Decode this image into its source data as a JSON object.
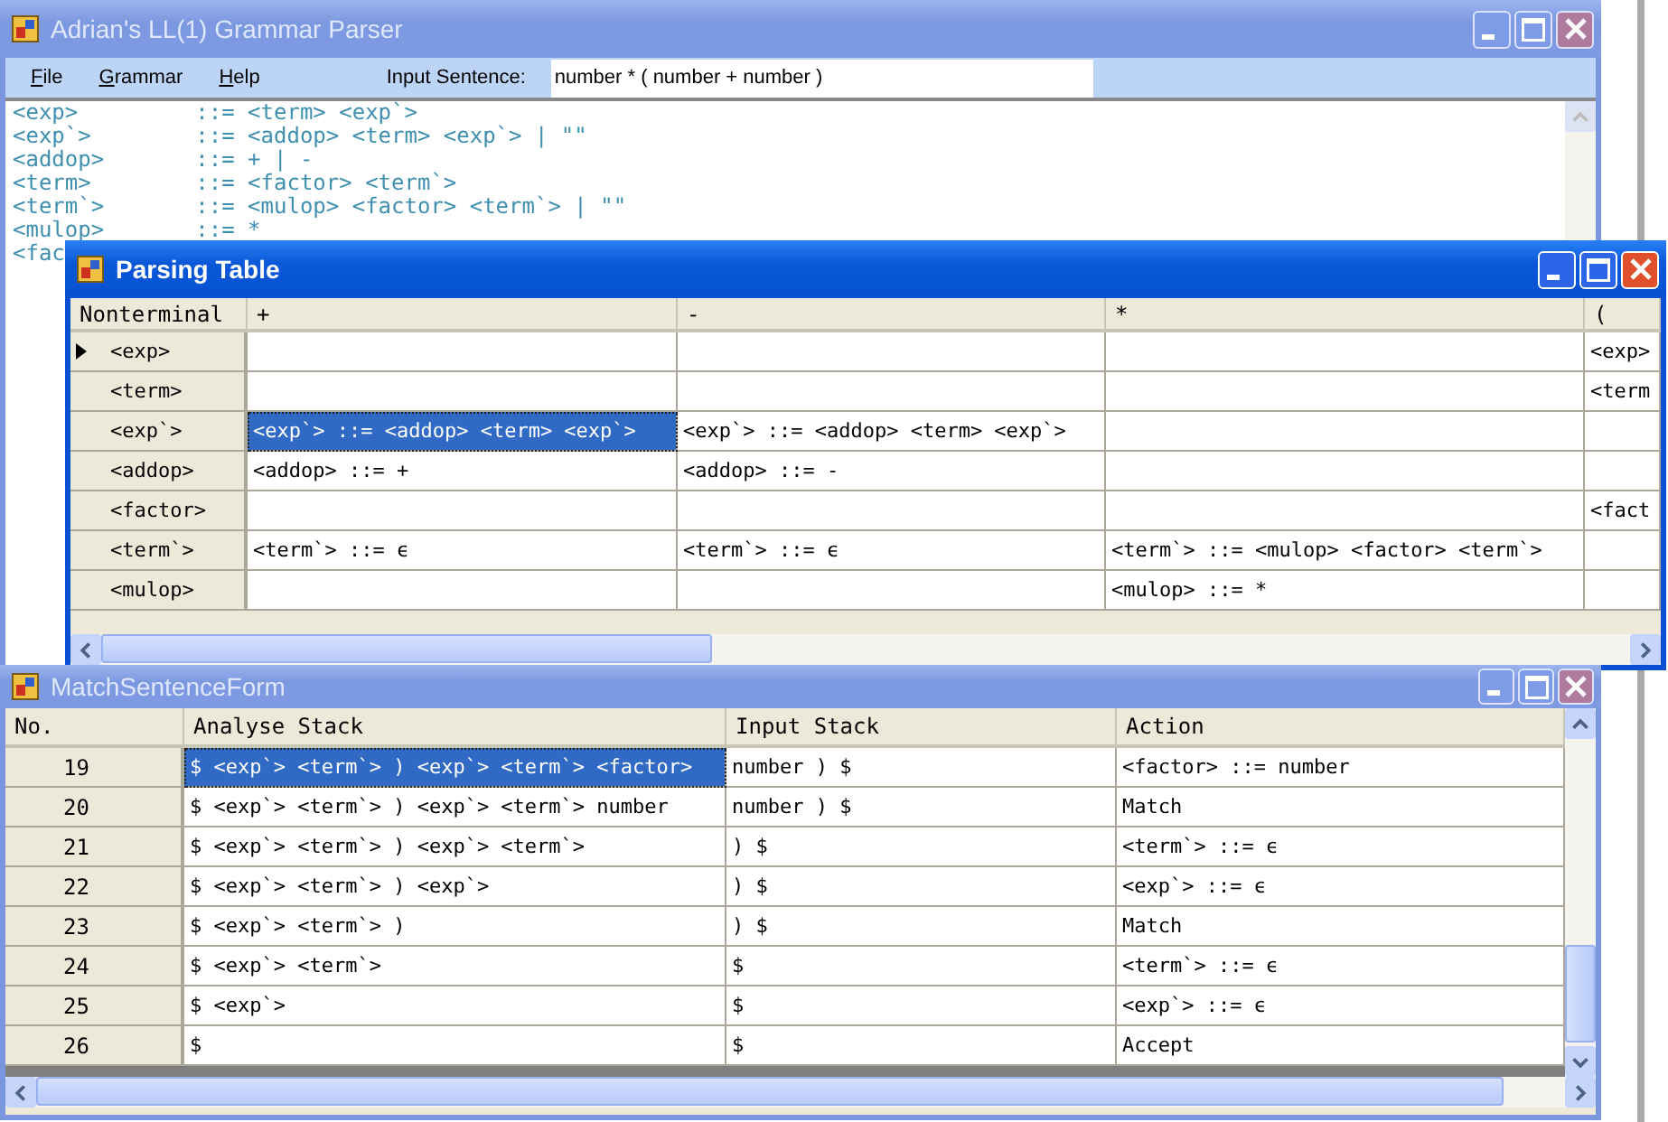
{
  "main_window": {
    "title": "Adrian's LL(1) Grammar Parser",
    "active": false,
    "menu": [
      {
        "label": "File"
      },
      {
        "label": "Grammar"
      },
      {
        "label": "Help"
      }
    ],
    "input_label": "Input Sentence:",
    "input_value": "number * ( number + number )",
    "grammar_lines": [
      "<exp>         ::= <term> <exp`>",
      "<exp`>        ::= <addop> <term> <exp`> | \"\"",
      "<addop>       ::= + | -",
      "<term>        ::= <factor> <term`>",
      "<term`>       ::= <mulop> <factor> <term`> | \"\"",
      "<mulop>       ::= *",
      "<fac"
    ]
  },
  "parsing_table": {
    "title": "Parsing Table",
    "active": true,
    "row_header_column": "Nonterminal",
    "columns": [
      "+",
      "-",
      "*",
      "("
    ],
    "rows": [
      {
        "header": "<exp>",
        "current": true,
        "cells": [
          {
            "selected": false
          },
          {
            "selected": false
          },
          {
            "selected": false
          },
          {
            "text": "<exp>",
            "selected": false
          }
        ]
      },
      {
        "header": "<term>",
        "current": false,
        "cells": [
          {
            "selected": false
          },
          {
            "selected": false
          },
          {
            "selected": false
          },
          {
            "text": "<term",
            "selected": false
          }
        ]
      },
      {
        "header": "<exp`>",
        "current": false,
        "cells": [
          {
            "text": "<exp`> ::= <addop> <term> <exp`>",
            "selected": true
          },
          {
            "text": "<exp`> ::= <addop> <term> <exp`>",
            "selected": false
          },
          {
            "selected": false
          },
          {
            "selected": false
          }
        ]
      },
      {
        "header": "<addop>",
        "current": false,
        "cells": [
          {
            "text": "<addop> ::= +",
            "selected": false
          },
          {
            "text": "<addop> ::= -",
            "selected": false
          },
          {
            "selected": false
          },
          {
            "selected": false
          }
        ]
      },
      {
        "header": "<factor>",
        "current": false,
        "cells": [
          {
            "selected": false
          },
          {
            "selected": false
          },
          {
            "selected": false
          },
          {
            "text": "<fact",
            "selected": false
          }
        ]
      },
      {
        "header": "<term`>",
        "current": false,
        "cells": [
          {
            "text": "<term`> ::= ϵ",
            "selected": false
          },
          {
            "text": "<term`> ::= ϵ",
            "selected": false
          },
          {
            "text": "<term`> ::= <mulop> <factor> <term`>",
            "selected": false
          },
          {
            "selected": false
          }
        ]
      },
      {
        "header": "<mulop>",
        "current": false,
        "cells": [
          {
            "selected": false
          },
          {
            "selected": false
          },
          {
            "text": "<mulop> ::= *",
            "selected": false
          },
          {
            "selected": false
          }
        ]
      }
    ]
  },
  "match_window": {
    "title": "MatchSentenceForm",
    "active": false,
    "row_header_column": "No.",
    "columns": [
      "Analyse Stack",
      "Input Stack",
      "Action"
    ],
    "rows": [
      {
        "no": "19",
        "cells": [
          {
            "text": "$ <exp`> <term`> ) <exp`> <term`> <factor>",
            "selected": true
          },
          {
            "text": "number ) $",
            "selected": false
          },
          {
            "text": "<factor> ::= number",
            "selected": false
          }
        ]
      },
      {
        "no": "20",
        "cells": [
          {
            "text": "$ <exp`> <term`> ) <exp`> <term`> number",
            "selected": false
          },
          {
            "text": "number ) $",
            "selected": false
          },
          {
            "text": "Match",
            "selected": false
          }
        ]
      },
      {
        "no": "21",
        "cells": [
          {
            "text": "$ <exp`> <term`> ) <exp`> <term`>",
            "selected": false
          },
          {
            "text": ") $",
            "selected": false
          },
          {
            "text": "<term`> ::= ϵ",
            "selected": false
          }
        ]
      },
      {
        "no": "22",
        "cells": [
          {
            "text": "$ <exp`> <term`> ) <exp`>",
            "selected": false
          },
          {
            "text": ") $",
            "selected": false
          },
          {
            "text": "<exp`> ::= ϵ",
            "selected": false
          }
        ]
      },
      {
        "no": "23",
        "cells": [
          {
            "text": "$ <exp`> <term`> )",
            "selected": false
          },
          {
            "text": ") $",
            "selected": false
          },
          {
            "text": "Match",
            "selected": false
          }
        ]
      },
      {
        "no": "24",
        "cells": [
          {
            "text": "$ <exp`> <term`>",
            "selected": false
          },
          {
            "text": "$",
            "selected": false
          },
          {
            "text": "<term`> ::= ϵ",
            "selected": false
          }
        ]
      },
      {
        "no": "25",
        "cells": [
          {
            "text": "$ <exp`>",
            "selected": false
          },
          {
            "text": "$",
            "selected": false
          },
          {
            "text": "<exp`> ::= ϵ",
            "selected": false
          }
        ]
      },
      {
        "no": "26",
        "cells": [
          {
            "text": "$",
            "selected": false
          },
          {
            "text": "$",
            "selected": false
          },
          {
            "text": "Accept",
            "selected": false
          }
        ]
      }
    ]
  }
}
